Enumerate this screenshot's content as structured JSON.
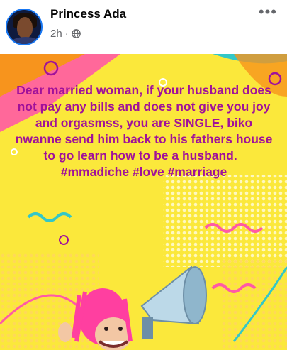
{
  "post": {
    "author": "Princess Ada",
    "time": "2h",
    "separator": "·",
    "privacy_icon": "globe-icon",
    "more_icon": "more-options-icon",
    "text": "Dear married woman, if your husband does not pay any bills and does not give you joy and orgasmss, you are SINGLE, biko nwanne send him back to his fathers house to go learn how to be a husband.",
    "hashtags": [
      "#mmadiche",
      "#love",
      "#marriage"
    ]
  },
  "colors": {
    "background": "#fbe83b",
    "text": "#a0119a",
    "accent_pink": "#ff4f9a",
    "accent_orange": "#f7941d",
    "accent_teal": "#33c7c7"
  }
}
